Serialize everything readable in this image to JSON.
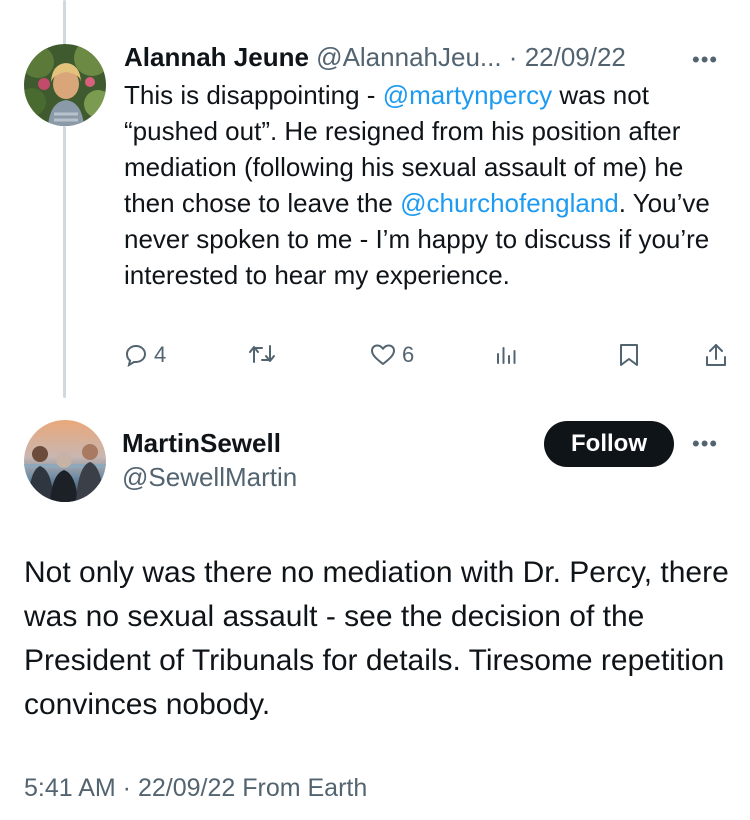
{
  "reply": {
    "author_name": "Alannah Jeune",
    "author_handle": "@AlannahJeu...",
    "separator": " · ",
    "date": "22/09/22",
    "more_icon": "more-horizontal-icon",
    "body": {
      "part1": "This is disappointing - ",
      "mention1": "@martynpercy",
      "part2": " was not “pushed out”. He resigned from his position after mediation (following his sexual assault of me) he then chose to leave the ",
      "mention2": "@churchofengland",
      "part3": ". You’ve never spoken to me - I’m happy to discuss if you’re interested to hear my experience."
    },
    "actions": {
      "reply_count": "4",
      "retweet_count": "",
      "like_count": "6"
    }
  },
  "tweet": {
    "author_name": "MartinSewell",
    "author_handle": "@SewellMartin",
    "follow_label": "Follow",
    "text": "Not only was there no mediation with Dr. Percy, there was no sexual assault - see the decision of the President of Tribunals for details. Tiresome repetition convinces nobody.",
    "time": "5:41 AM",
    "separator": " · ",
    "date": "22/09/22",
    "source": " From Earth"
  },
  "colors": {
    "link": "#1d9bf0",
    "muted": "#536471",
    "text": "#0f1419",
    "thread_line": "#cfd9de"
  }
}
